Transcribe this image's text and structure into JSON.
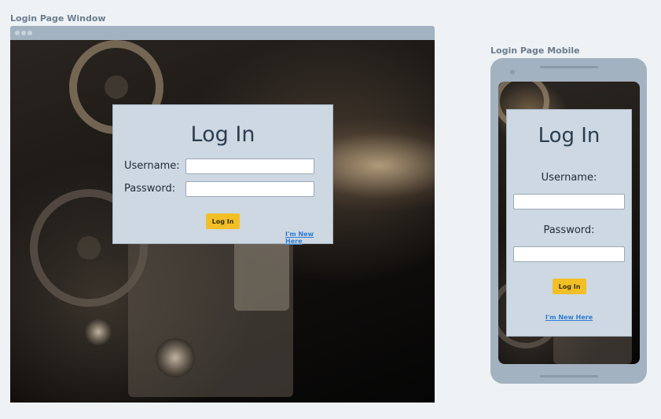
{
  "desktop": {
    "caption": "Login Page Window",
    "card": {
      "title": "Log In",
      "username_label": "Username:",
      "password_label": "Password:",
      "username_value": "",
      "password_value": "",
      "login_button": "Log In",
      "new_link": "I'm New Here"
    }
  },
  "mobile": {
    "caption": "Login Page Mobile",
    "card": {
      "title": "Log In",
      "username_label": "Username:",
      "password_label": "Password:",
      "username_value": "",
      "password_value": "",
      "login_button": "Log In",
      "new_link": "I'm New Here"
    }
  },
  "colors": {
    "card_background": "#cdd8e2",
    "button": "#f2bf26",
    "link": "#2f7dd1",
    "frame": "#a3b2c0"
  },
  "icons": {
    "background": "film-projector-image"
  }
}
